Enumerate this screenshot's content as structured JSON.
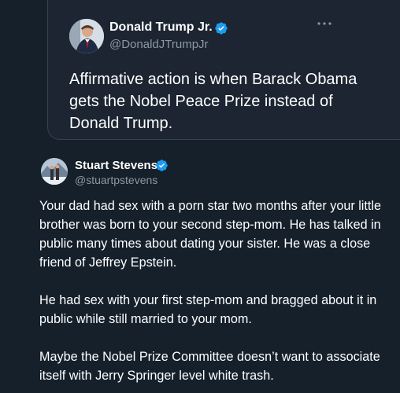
{
  "quoted_tweet": {
    "display_name": "Donald Trump Jr.",
    "handle": "@DonaldJTrumpJr",
    "text": "Affirmative action is when Barack Obama gets the Nobel Peace Prize instead of Donald Trump.",
    "verified_icon": "verified-badge-icon",
    "more_icon": "more-options-icon"
  },
  "reply_tweet": {
    "display_name": "Stuart Stevens",
    "handle": "@stuartpstevens",
    "paragraphs": [
      "Your dad had sex with a porn star two months after your little brother was born to your second step-mom. He has talked in public many times about dating your sister. He was a close friend of Jeffrey Epstein.",
      "He had sex with your first step-mom and bragged about it in public while still married to your mom.",
      "Maybe the Nobel Prize Committee doesn’t want to associate itself with Jerry Springer level white trash."
    ],
    "verified_icon": "verified-badge-icon"
  },
  "colors": {
    "background": "#15202b",
    "card": "#1c2531",
    "secondary_text": "#8b98a5",
    "verified_blue": "#1d9bf0"
  }
}
